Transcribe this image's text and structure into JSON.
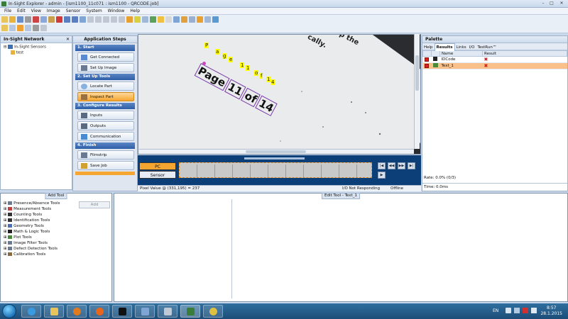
{
  "window": {
    "title": "In-Sight Explorer - admin - [ism1100_11c071 : ism1100 - QRCODE.job]",
    "controls": [
      "–",
      "□",
      "✕"
    ]
  },
  "menu": [
    "File",
    "Edit",
    "View",
    "Image",
    "Sensor",
    "System",
    "Window",
    "Help"
  ],
  "network": {
    "title": "In-Sight Network",
    "items": [
      "In-Sight Sensors",
      "test"
    ]
  },
  "steps": {
    "title": "Application Steps",
    "sections": [
      {
        "label": "1. Start",
        "buttons": [
          "Get Connected",
          "Set Up Image"
        ]
      },
      {
        "label": "2. Set Up Tools",
        "buttons": [
          "Locate Part",
          "Inspect Part"
        ]
      },
      {
        "label": "3. Configure Results",
        "buttons": [
          "Inputs",
          "Outputs",
          "Communication"
        ]
      },
      {
        "label": "4. Finish",
        "buttons": [
          "Filmstrip",
          "Save Job"
        ]
      }
    ]
  },
  "image": {
    "paper_text": "cally.",
    "paper_text2": "p the",
    "ocr_small": [
      "P",
      "a",
      "g",
      "e",
      "1",
      "1",
      "o",
      "f",
      "1",
      "4"
    ],
    "ocr_large": [
      "Page",
      "11",
      "of",
      "14"
    ]
  },
  "film": {
    "pc_label": "PC",
    "sensor_label": "Sensor",
    "nav": [
      "|◀",
      "◀◀",
      "▶▶",
      "▶|",
      "▶"
    ]
  },
  "status": {
    "pixel": "Pixel Value @ (331,195) = 237",
    "io": "I/O Not Responding",
    "state": "Offline"
  },
  "palette": {
    "title": "Palette",
    "tabs": [
      "Help",
      "Results",
      "Links",
      "I/O",
      "TestRun™"
    ],
    "columns": [
      "Name",
      "Result"
    ],
    "rows": [
      {
        "name": "IDCode",
        "result": "✖"
      },
      {
        "name": "Text_1",
        "result": "✖"
      }
    ],
    "rate": "Rate: 0.0% (0/3)",
    "time": "Time: 0.0ms"
  },
  "addtool": {
    "title": "Add Tool",
    "add_label": "Add",
    "items": [
      "Presence/Absence Tools",
      "Measurement Tools",
      "Counting Tools",
      "Identification Tools",
      "Geometry Tools",
      "Math & Logic Tools",
      "Plot Tools",
      "Image Filter Tools",
      "Defect Detection Tools",
      "Calibration Tools"
    ]
  },
  "edittool": {
    "title": "Edit Tool - Text_1"
  },
  "taskbar": {
    "lang": "EN",
    "time": "8:57",
    "date": "28.1.2015"
  },
  "colors": {
    "accent": "#f5a630",
    "film_bg": "#0c3f78",
    "ocr_yellow": "#ffff00",
    "row_highlight": "#f9c089"
  }
}
